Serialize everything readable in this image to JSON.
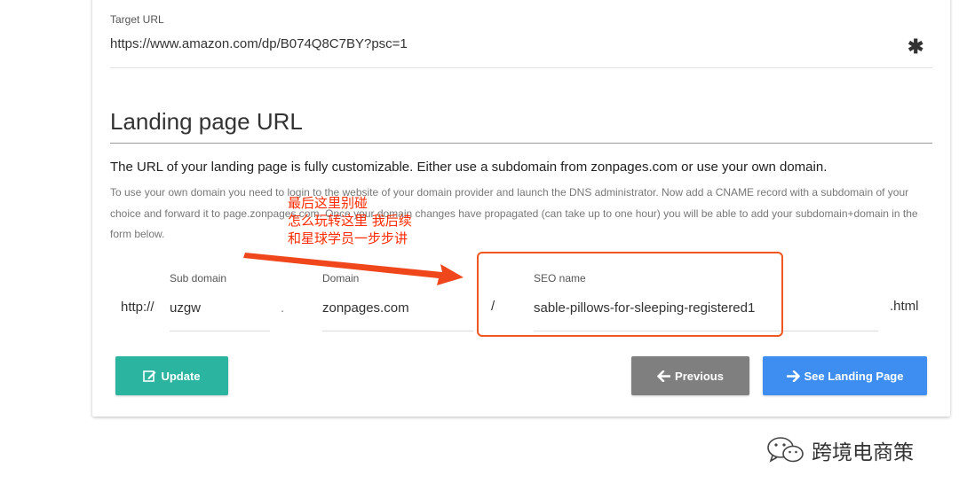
{
  "target": {
    "label": "Target URL",
    "value": "https://www.amazon.com/dp/B074Q8C7BY?psc=1",
    "required_mark": "✱"
  },
  "landing": {
    "title": "Landing page URL",
    "description": "The URL of your landing page is fully customizable. Either use a subdomain from zonpages.com or use your own domain.",
    "help_text": "To use your own domain you need to login to the website of your domain provider and launch the DNS administrator. Now add a CNAME record with a subdomain of your choice and forward it to page.zonpages.com. Once your domain changes have propagated (can take up to one hour) you will be able to add your subdomain+domain in the form below."
  },
  "url_form": {
    "prefix": "http://",
    "subdomain": {
      "label": "Sub domain",
      "value": "uzgw"
    },
    "dot": ".",
    "domain": {
      "label": "Domain",
      "value": "zonpages.com"
    },
    "slash": "/",
    "seo": {
      "label": "SEO name",
      "value": "sable-pillows-for-sleeping-registered1"
    },
    "suffix": ".html"
  },
  "buttons": {
    "update": "Update",
    "previous": "Previous",
    "see_landing": "See Landing Page"
  },
  "annotation": {
    "line1": "最后这里别碰",
    "line2": "怎么玩转这里 我后续",
    "line3": "和星球学员一步步讲"
  },
  "watermark": {
    "text": "跨境电商策"
  },
  "colors": {
    "update_btn": "#2bb5a0",
    "previous_btn": "#7f7f7f",
    "see_landing_btn": "#3d8ef0",
    "annotation": "#ff2a00",
    "highlight_border": "#f0561f"
  }
}
